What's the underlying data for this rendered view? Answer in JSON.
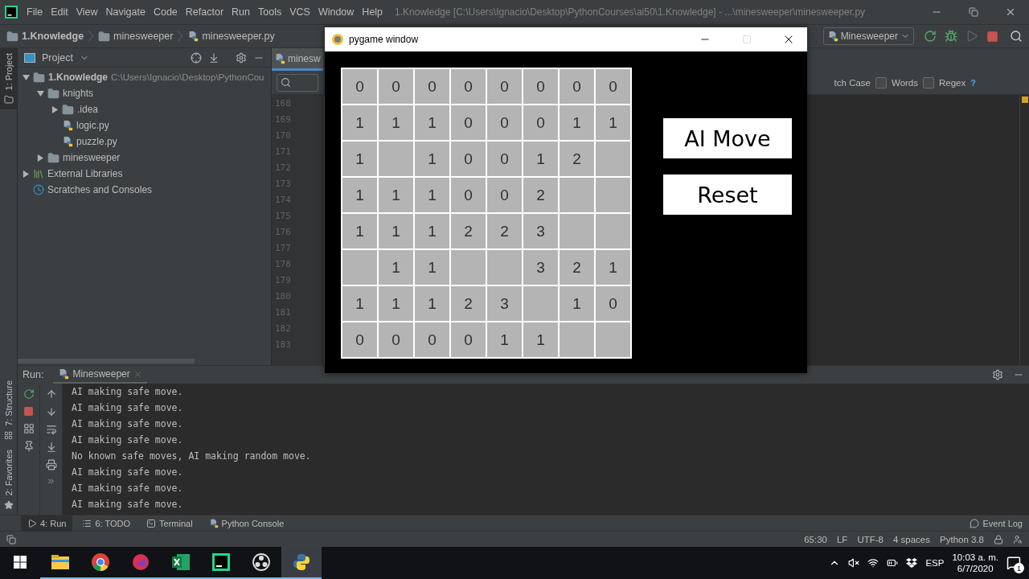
{
  "ide": {
    "title": "1.Knowledge [C:\\Users\\Ignacio\\Desktop\\PythonCourses\\ai50\\1.Knowledge] - ...\\minesweeper\\minesweeper.py",
    "menu": [
      "File",
      "Edit",
      "View",
      "Navigate",
      "Code",
      "Refactor",
      "Run",
      "Tools",
      "VCS",
      "Window",
      "Help"
    ],
    "breadcrumbs": [
      {
        "label": "1.Knowledge",
        "kind": "folder"
      },
      {
        "label": "minesweeper",
        "kind": "folder"
      },
      {
        "label": "minesweeper.py",
        "kind": "file"
      }
    ],
    "run_config": "Minesweeper"
  },
  "left_stripe_top": [
    {
      "label": "1: Project",
      "selected": true
    }
  ],
  "left_stripe_bottom": [
    {
      "label": "7: Structure",
      "selected": false
    },
    {
      "label": "2: Favorites",
      "selected": false
    }
  ],
  "project": {
    "title": "Project",
    "tree": [
      {
        "label": "1.Knowledge",
        "kind": "project",
        "path": "C:\\Users\\Ignacio\\Desktop\\PythonCou",
        "expanded": true,
        "children": [
          {
            "label": "knights",
            "kind": "folder",
            "expanded": true,
            "children": [
              {
                "label": ".idea",
                "kind": "folder",
                "expanded": false
              },
              {
                "label": "logic.py",
                "kind": "file"
              },
              {
                "label": "puzzle.py",
                "kind": "file"
              }
            ]
          },
          {
            "label": "minesweeper",
            "kind": "folder",
            "expanded": false
          }
        ]
      },
      {
        "label": "External Libraries",
        "kind": "library",
        "expanded": false
      },
      {
        "label": "Scratches and Consoles",
        "kind": "scratches"
      }
    ]
  },
  "editor": {
    "tab": "minesw",
    "search_options": [
      {
        "label": "tch Case",
        "kind": "label"
      },
      {
        "label": "Words",
        "kind": "checkbox",
        "checked": false
      },
      {
        "label": "Regex",
        "kind": "checkbox",
        "checked": false
      }
    ],
    "help": "?",
    "line_numbers": [
      "168",
      "169",
      "170",
      "171",
      "172",
      "173",
      "174",
      "175",
      "176",
      "177",
      "178",
      "179",
      "180",
      "181",
      "182",
      "183"
    ]
  },
  "run": {
    "label": "Run:",
    "tab": "Minesweeper",
    "console": [
      "AI making safe move.",
      "AI making safe move.",
      "AI making safe move.",
      "AI making safe move.",
      "No known safe moves, AI making random move.",
      "AI making safe move.",
      "AI making safe move.",
      "AI making safe move."
    ]
  },
  "bottom_tabs": [
    {
      "label": "4: Run",
      "kind": "run",
      "selected": true
    },
    {
      "label": "6: TODO",
      "kind": "todo",
      "selected": false
    },
    {
      "label": "Terminal",
      "kind": "terminal",
      "selected": false
    },
    {
      "label": "Python Console",
      "kind": "console",
      "selected": false
    }
  ],
  "event_log": "Event Log",
  "status_bar": [
    "65:30",
    "LF",
    "UTF-8",
    "4 spaces",
    "Python 3.8"
  ],
  "taskbar": {
    "apps": [
      {
        "kind": "explorer",
        "selected": false
      },
      {
        "kind": "chrome",
        "selected": false
      },
      {
        "kind": "cleaner",
        "selected": false
      },
      {
        "kind": "excel",
        "selected": false
      },
      {
        "kind": "pycharm",
        "selected": false
      },
      {
        "kind": "obs",
        "selected": false
      },
      {
        "kind": "python",
        "selected": true
      }
    ],
    "language": "ESP",
    "time": "10:03 a. m.",
    "date": "6/7/2020",
    "notifications": "1"
  },
  "pygame": {
    "title": "pygame window",
    "board": [
      [
        {
          "kind": "number",
          "text": "0"
        },
        {
          "kind": "number",
          "text": "0"
        },
        {
          "kind": "number",
          "text": "0"
        },
        {
          "kind": "number",
          "text": "0"
        },
        {
          "kind": "number",
          "text": "0"
        },
        {
          "kind": "number",
          "text": "0"
        },
        {
          "kind": "number",
          "text": "0"
        },
        {
          "kind": "number",
          "text": "0"
        }
      ],
      [
        {
          "kind": "number",
          "text": "1"
        },
        {
          "kind": "number",
          "text": "1"
        },
        {
          "kind": "number",
          "text": "1"
        },
        {
          "kind": "number",
          "text": "0"
        },
        {
          "kind": "number",
          "text": "0"
        },
        {
          "kind": "number",
          "text": "0"
        },
        {
          "kind": "number",
          "text": "1"
        },
        {
          "kind": "number",
          "text": "1"
        }
      ],
      [
        {
          "kind": "number",
          "text": "1"
        },
        {
          "kind": "blank"
        },
        {
          "kind": "number",
          "text": "1"
        },
        {
          "kind": "number",
          "text": "0"
        },
        {
          "kind": "number",
          "text": "0"
        },
        {
          "kind": "number",
          "text": "1"
        },
        {
          "kind": "number",
          "text": "2"
        },
        {
          "kind": "blank"
        }
      ],
      [
        {
          "kind": "number",
          "text": "1"
        },
        {
          "kind": "number",
          "text": "1"
        },
        {
          "kind": "number",
          "text": "1"
        },
        {
          "kind": "number",
          "text": "0"
        },
        {
          "kind": "number",
          "text": "0"
        },
        {
          "kind": "number",
          "text": "2"
        },
        {
          "kind": "blank"
        },
        {
          "kind": "blank"
        }
      ],
      [
        {
          "kind": "number",
          "text": "1"
        },
        {
          "kind": "number",
          "text": "1"
        },
        {
          "kind": "number",
          "text": "1"
        },
        {
          "kind": "number",
          "text": "2"
        },
        {
          "kind": "number",
          "text": "2"
        },
        {
          "kind": "number",
          "text": "3"
        },
        {
          "kind": "blank"
        },
        {
          "kind": "blank"
        }
      ],
      [
        {
          "kind": "blank"
        },
        {
          "kind": "number",
          "text": "1"
        },
        {
          "kind": "number",
          "text": "1"
        },
        {
          "kind": "blank"
        },
        {
          "kind": "blank"
        },
        {
          "kind": "number",
          "text": "3"
        },
        {
          "kind": "number",
          "text": "2"
        },
        {
          "kind": "number",
          "text": "1"
        }
      ],
      [
        {
          "kind": "number",
          "text": "1"
        },
        {
          "kind": "number",
          "text": "1"
        },
        {
          "kind": "number",
          "text": "1"
        },
        {
          "kind": "number",
          "text": "2"
        },
        {
          "kind": "number",
          "text": "3"
        },
        {
          "kind": "blank"
        },
        {
          "kind": "number",
          "text": "1"
        },
        {
          "kind": "number",
          "text": "0"
        }
      ],
      [
        {
          "kind": "number",
          "text": "0"
        },
        {
          "kind": "number",
          "text": "0"
        },
        {
          "kind": "number",
          "text": "0"
        },
        {
          "kind": "number",
          "text": "0"
        },
        {
          "kind": "number",
          "text": "1"
        },
        {
          "kind": "number",
          "text": "1"
        },
        {
          "kind": "blank"
        },
        {
          "kind": "blank"
        }
      ]
    ],
    "buttons": [
      "AI Move",
      "Reset"
    ]
  }
}
